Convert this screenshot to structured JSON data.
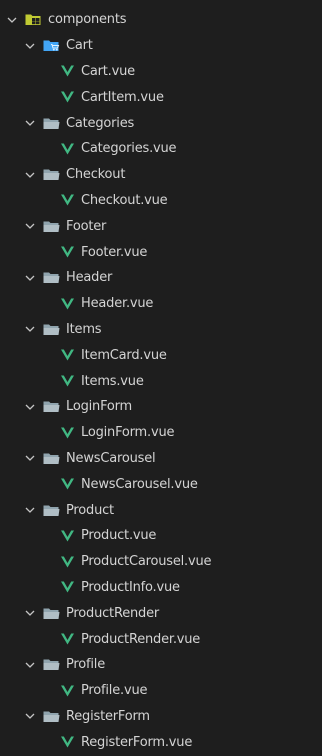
{
  "explorer": {
    "root": {
      "label": "components",
      "icon": "components-folder-open-icon",
      "chevron": "chevron-down-icon"
    },
    "folders": [
      {
        "label": "Cart",
        "icon": "cart-folder-open-icon",
        "chevron": "chevron-down-icon",
        "files": [
          "Cart.vue",
          "CartItem.vue"
        ]
      },
      {
        "label": "Categories",
        "icon": "folder-open-icon",
        "chevron": "chevron-down-icon",
        "files": [
          "Categories.vue"
        ]
      },
      {
        "label": "Checkout",
        "icon": "folder-open-icon",
        "chevron": "chevron-down-icon",
        "files": [
          "Checkout.vue"
        ]
      },
      {
        "label": "Footer",
        "icon": "folder-open-icon",
        "chevron": "chevron-down-icon",
        "files": [
          "Footer.vue"
        ]
      },
      {
        "label": "Header",
        "icon": "folder-open-icon",
        "chevron": "chevron-down-icon",
        "files": [
          "Header.vue"
        ]
      },
      {
        "label": "Items",
        "icon": "folder-open-icon",
        "chevron": "chevron-down-icon",
        "files": [
          "ItemCard.vue",
          "Items.vue"
        ]
      },
      {
        "label": "LoginForm",
        "icon": "folder-open-icon",
        "chevron": "chevron-down-icon",
        "files": [
          "LoginForm.vue"
        ]
      },
      {
        "label": "NewsCarousel",
        "icon": "folder-open-icon",
        "chevron": "chevron-down-icon",
        "files": [
          "NewsCarousel.vue"
        ]
      },
      {
        "label": "Product",
        "icon": "folder-open-icon",
        "chevron": "chevron-down-icon",
        "files": [
          "Product.vue",
          "ProductCarousel.vue",
          "ProductInfo.vue"
        ]
      },
      {
        "label": "ProductRender",
        "icon": "folder-open-icon",
        "chevron": "chevron-down-icon",
        "files": [
          "ProductRender.vue"
        ]
      },
      {
        "label": "Profile",
        "icon": "folder-open-icon",
        "chevron": "chevron-down-icon",
        "files": [
          "Profile.vue"
        ]
      },
      {
        "label": "RegisterForm",
        "icon": "folder-open-icon",
        "chevron": "chevron-down-icon",
        "files": [
          "RegisterForm.vue"
        ]
      }
    ],
    "file_icon": "vue-file-icon"
  },
  "colors": {
    "background": "#1e1e1e",
    "text": "#d4d4d4",
    "chevron": "#c5c5c5",
    "folder": "#90a4ae",
    "components_folder": "#c0ca33",
    "cart_folder": "#42a5f5",
    "vue": "#41b883"
  }
}
